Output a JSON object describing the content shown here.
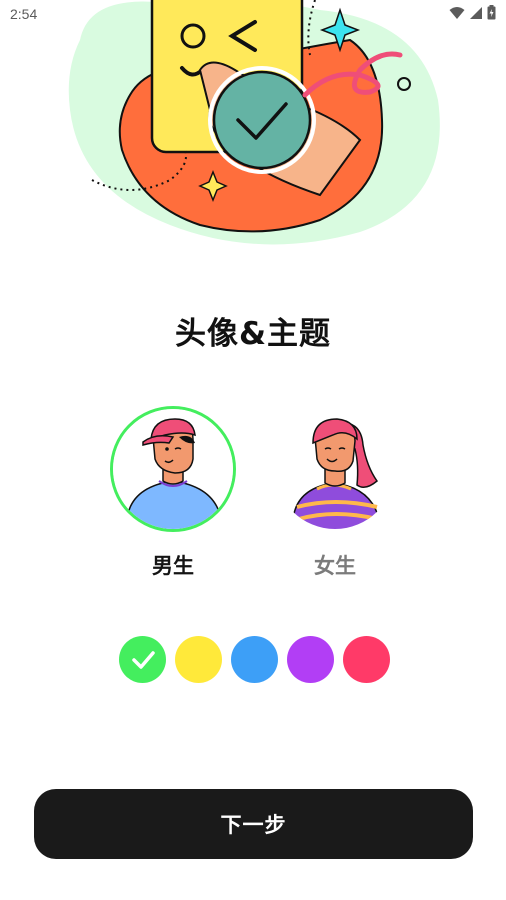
{
  "status_bar": {
    "time": "2:54",
    "icons": [
      "wifi-icon",
      "signal-icon",
      "battery-icon"
    ]
  },
  "hero": {
    "icon": "phone-check-illustration"
  },
  "title": "头像&主题",
  "genders": [
    {
      "label": "男生",
      "selected": true,
      "avatar": "male-avatar"
    },
    {
      "label": "女生",
      "selected": false,
      "avatar": "female-avatar"
    }
  ],
  "theme_colors": [
    {
      "color": "#44ee5e",
      "selected": true
    },
    {
      "color": "#ffe93a",
      "selected": false
    },
    {
      "color": "#3d9ff7",
      "selected": false
    },
    {
      "color": "#b23ef5",
      "selected": false
    },
    {
      "color": "#ff3a68",
      "selected": false
    }
  ],
  "next_button": {
    "label": "下一步"
  },
  "colors": {
    "accent": "#44ee5e",
    "button_bg": "#1a1a1a"
  }
}
